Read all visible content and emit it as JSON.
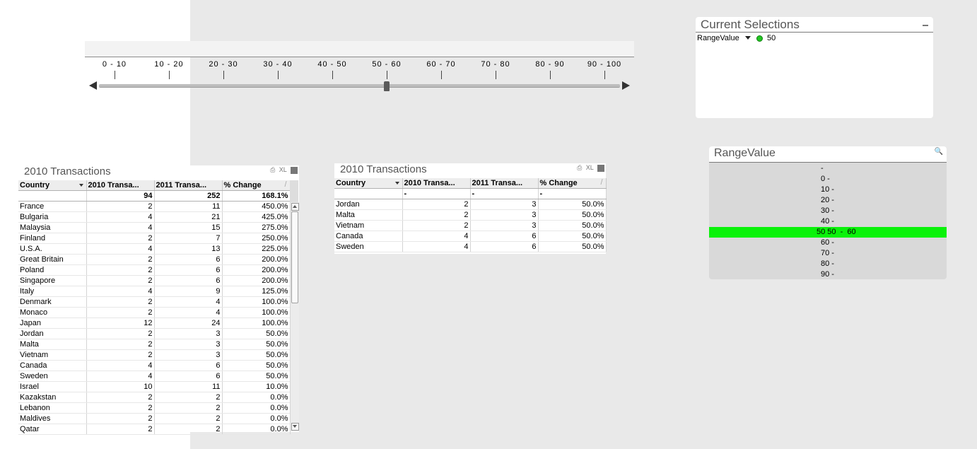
{
  "slider": {
    "ticks": [
      "0 - 10",
      "10 - 20",
      "20 - 30",
      "30 - 40",
      "40 - 50",
      "50 - 60",
      "60 - 70",
      "70 - 80",
      "80 - 90",
      "90 - 100"
    ]
  },
  "current_selections": {
    "title": "Current Selections",
    "field": "RangeValue",
    "value": "50"
  },
  "range_listbox": {
    "title": "RangeValue",
    "items": [
      {
        "label": "-",
        "selected": false
      },
      {
        "label": "0 -",
        "selected": false
      },
      {
        "label": "10 -",
        "selected": false
      },
      {
        "label": "20 -",
        "selected": false
      },
      {
        "label": "30 -",
        "selected": false
      },
      {
        "label": "40 -",
        "selected": false
      },
      {
        "label": "50 50  -  60",
        "selected": true
      },
      {
        "label": "60 -",
        "selected": false
      },
      {
        "label": "70 -",
        "selected": false
      },
      {
        "label": "80 -",
        "selected": false
      },
      {
        "label": "90 -",
        "selected": false
      }
    ],
    "colors": {
      "selected": "#0af20a",
      "background": "#d9d9d9"
    }
  },
  "table_left": {
    "title": "2010 Transactions",
    "icons": {
      "print": "⎙",
      "xl": "XL"
    },
    "headers": [
      "Country",
      "2010 Transa...",
      "2011 Transa...",
      "% Change"
    ],
    "totals": [
      "",
      "94",
      "252",
      "168.1%"
    ],
    "rows": [
      [
        "France",
        "2",
        "11",
        "450.0%"
      ],
      [
        "Bulgaria",
        "4",
        "21",
        "425.0%"
      ],
      [
        "Malaysia",
        "4",
        "15",
        "275.0%"
      ],
      [
        "Finland",
        "2",
        "7",
        "250.0%"
      ],
      [
        "U.S.A.",
        "4",
        "13",
        "225.0%"
      ],
      [
        "Great Britain",
        "2",
        "6",
        "200.0%"
      ],
      [
        "Poland",
        "2",
        "6",
        "200.0%"
      ],
      [
        "Singapore",
        "2",
        "6",
        "200.0%"
      ],
      [
        "Italy",
        "4",
        "9",
        "125.0%"
      ],
      [
        "Denmark",
        "2",
        "4",
        "100.0%"
      ],
      [
        "Monaco",
        "2",
        "4",
        "100.0%"
      ],
      [
        "Japan",
        "12",
        "24",
        "100.0%"
      ],
      [
        "Jordan",
        "2",
        "3",
        "50.0%"
      ],
      [
        "Malta",
        "2",
        "3",
        "50.0%"
      ],
      [
        "Vietnam",
        "2",
        "3",
        "50.0%"
      ],
      [
        "Canada",
        "4",
        "6",
        "50.0%"
      ],
      [
        "Sweden",
        "4",
        "6",
        "50.0%"
      ],
      [
        "Israel",
        "10",
        "11",
        "10.0%"
      ],
      [
        "Kazakstan",
        "2",
        "2",
        "0.0%"
      ],
      [
        "Lebanon",
        "2",
        "2",
        "0.0%"
      ],
      [
        "Maldives",
        "2",
        "2",
        "0.0%"
      ],
      [
        "Qatar",
        "2",
        "2",
        "0.0%"
      ]
    ]
  },
  "table_right": {
    "title": "2010 Transactions",
    "icons": {
      "print": "⎙",
      "xl": "XL"
    },
    "headers": [
      "Country",
      "2010 Transa...",
      "2011 Transa...",
      "% Change"
    ],
    "totals": [
      "",
      "-",
      "-",
      "-"
    ],
    "rows": [
      [
        "Jordan",
        "2",
        "3",
        "50.0%"
      ],
      [
        "Malta",
        "2",
        "3",
        "50.0%"
      ],
      [
        "Vietnam",
        "2",
        "3",
        "50.0%"
      ],
      [
        "Canada",
        "4",
        "6",
        "50.0%"
      ],
      [
        "Sweden",
        "4",
        "6",
        "50.0%"
      ]
    ]
  }
}
